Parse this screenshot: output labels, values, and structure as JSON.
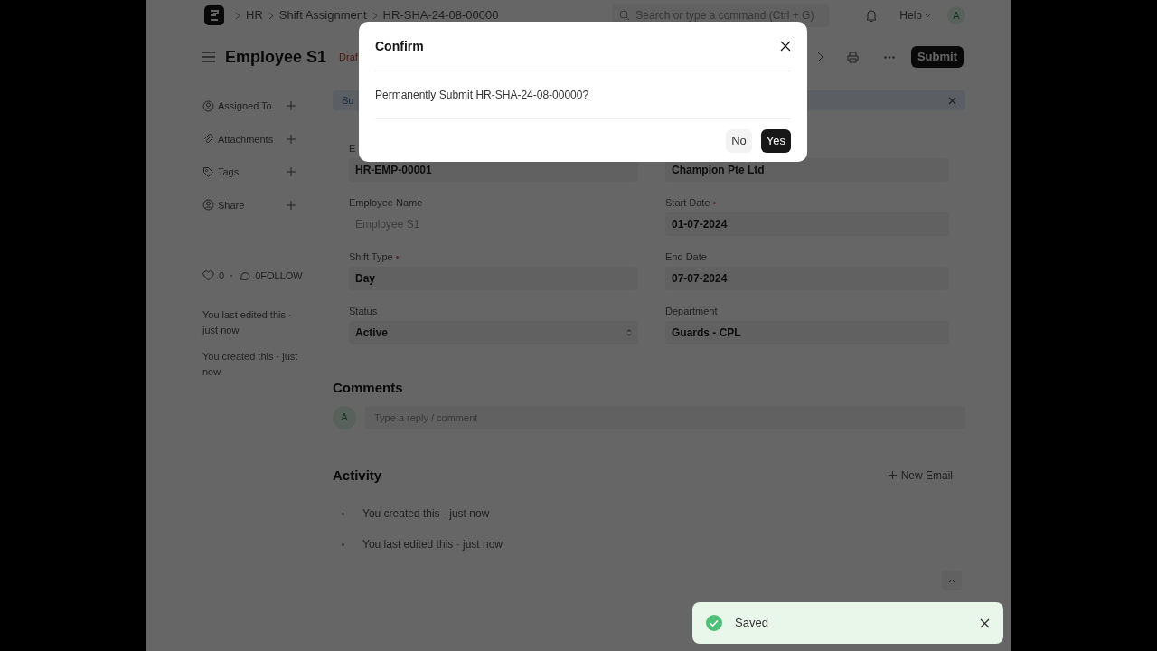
{
  "navbar": {
    "breadcrumbs": [
      "HR",
      "Shift Assignment",
      "HR-SHA-24-08-00000"
    ],
    "search": {
      "placeholder": "Search or type a command (Ctrl + G)"
    },
    "help": "Help",
    "avatar": "A"
  },
  "page": {
    "title": "Employee S1",
    "status": "Draf",
    "submit": "Submit"
  },
  "banner": {
    "text": "Su"
  },
  "sidebar": {
    "items": [
      {
        "label": "Assigned To",
        "kind": "assign"
      },
      {
        "label": "Attachments",
        "kind": "attach"
      },
      {
        "label": "Tags",
        "kind": "tag"
      },
      {
        "label": "Share",
        "kind": "share"
      }
    ],
    "likes": "0",
    "follow": "0FOLLOW",
    "timeline": [
      "You last edited this · just now",
      "You created this · just now"
    ]
  },
  "fields": {
    "left": [
      {
        "label": "E",
        "value": "HR-EMP-00001",
        "kind": "text",
        "disabled": false,
        "required": false
      },
      {
        "label": "Employee Name",
        "value": "Employee S1",
        "kind": "text",
        "disabled": true,
        "required": false
      },
      {
        "label": "Shift Type",
        "value": "Day",
        "kind": "text",
        "disabled": false,
        "required": true
      },
      {
        "label": "Status",
        "value": "Active",
        "kind": "select",
        "disabled": false,
        "required": false
      }
    ],
    "right": [
      {
        "value": "Champion Pte Ltd",
        "kind": "text",
        "disabled": false,
        "required": false
      },
      {
        "label": "Start Date",
        "value": "01-07-2024",
        "kind": "text",
        "disabled": false,
        "required": true
      },
      {
        "label": "End Date",
        "value": "07-07-2024",
        "kind": "text",
        "disabled": false,
        "required": false
      },
      {
        "label": "Department",
        "value": "Guards - CPL",
        "kind": "text",
        "disabled": false,
        "required": false
      }
    ]
  },
  "comments": {
    "title": "Comments",
    "avatar": "A",
    "placeholder": "Type a reply / comment"
  },
  "activity": {
    "title": "Activity",
    "new_email": "New Email",
    "items": [
      "You created this · just now",
      "You last edited this · just now"
    ]
  },
  "dialog": {
    "title": "Confirm",
    "message": "Permanently Submit HR-SHA-24-08-00000?",
    "buttons": [
      {
        "label": "No",
        "kind": "secondary"
      },
      {
        "label": "Yes",
        "kind": "primary"
      }
    ]
  },
  "toast": {
    "message": "Saved",
    "kind": "success"
  }
}
